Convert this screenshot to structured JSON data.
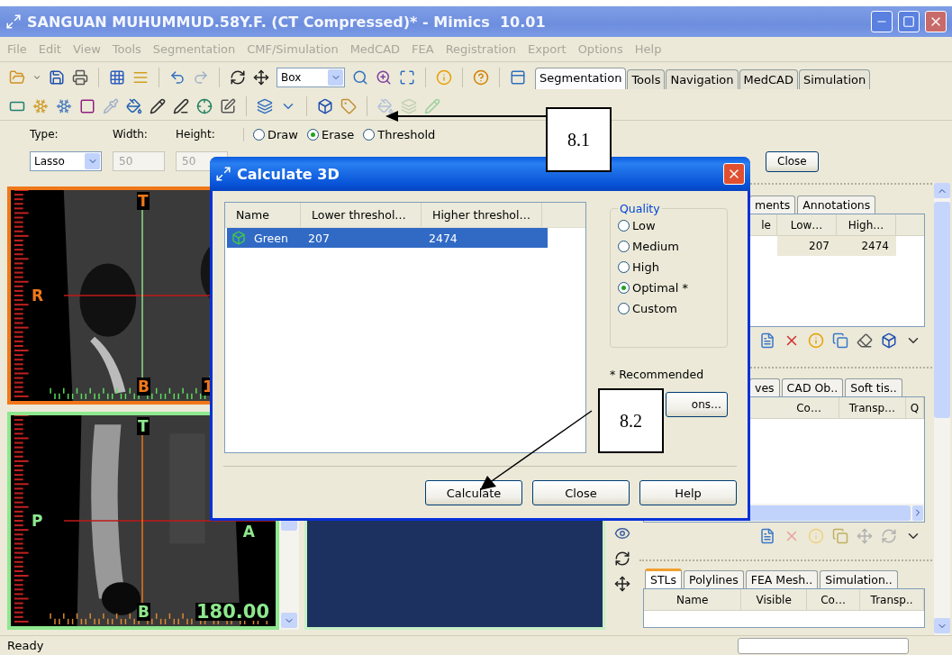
{
  "window": {
    "title": "SANGUAN MUHUMMUD.58Y.F. (CT Compressed)* - Mimics  10.01"
  },
  "menu": [
    "File",
    "Edit",
    "View",
    "Tools",
    "Segmentation",
    "CMF/Simulation",
    "MedCAD",
    "FEA",
    "Registration",
    "Export",
    "Options",
    "Help"
  ],
  "toolbar": {
    "view_mode": "Box"
  },
  "toolbar_tabs": [
    {
      "label": "Segmentation",
      "selected": true
    },
    {
      "label": "Tools",
      "selected": false
    },
    {
      "label": "Navigation",
      "selected": false
    },
    {
      "label": "MedCAD",
      "selected": false
    },
    {
      "label": "Simulation",
      "selected": false
    }
  ],
  "edit_options": {
    "type_label": "Type:",
    "type_value": "Lasso",
    "width_label": "Width:",
    "width_value": "50",
    "height_label": "Height:",
    "height_value": "50",
    "modes": [
      {
        "label": "Draw",
        "selected": false
      },
      {
        "label": "Erase",
        "selected": true
      },
      {
        "label": "Threshold",
        "selected": false
      }
    ],
    "close": "Close"
  },
  "viewports": [
    {
      "color": "#f07818",
      "markers": [
        {
          "text": "T",
          "kind": "top"
        },
        {
          "text": "R",
          "kind": "left"
        },
        {
          "text": "B",
          "kind": "bottom"
        },
        {
          "text": "1",
          "kind": "cut"
        }
      ]
    },
    {
      "color": "#8ee88e",
      "markers": [
        {
          "text": "T",
          "kind": "top"
        },
        {
          "text": "P",
          "kind": "left"
        },
        {
          "text": "A",
          "kind": "right"
        },
        {
          "text": "B",
          "kind": "bottom"
        },
        {
          "text": "180.00",
          "kind": "corner"
        }
      ]
    }
  ],
  "panels": [
    {
      "tabs": [
        {
          "label": "ments",
          "selected": false
        },
        {
          "label": "Annotations",
          "selected": false
        }
      ],
      "columns": [
        "le",
        "Low…",
        "High…"
      ],
      "rows": [
        [
          "",
          "207",
          "2474"
        ]
      ]
    },
    {
      "tabs": [
        {
          "label": "ves",
          "selected": false
        },
        {
          "label": "CAD Ob..",
          "selected": false
        },
        {
          "label": "Soft tis..",
          "selected": false
        }
      ],
      "columns": [
        "Co…",
        "Transp…",
        "Q"
      ]
    },
    {
      "tabs": [
        {
          "label": "STLs",
          "selected": true
        },
        {
          "label": "Polylines",
          "selected": false
        },
        {
          "label": "FEA Mesh..",
          "selected": false
        },
        {
          "label": "Simulation..",
          "selected": false
        }
      ],
      "columns": [
        "Name",
        "Visible",
        "Co…",
        "Transp.."
      ]
    }
  ],
  "status_bar": {
    "text": "Ready"
  },
  "dialog": {
    "title": "Calculate 3D",
    "columns": [
      "Name",
      "Lower threshol…",
      "Higher threshol…"
    ],
    "rows": [
      {
        "name": "Green",
        "lower": "207",
        "higher": "2474",
        "selected": true
      }
    ],
    "quality": {
      "title": "Quality",
      "options": [
        {
          "label": "Low",
          "selected": false
        },
        {
          "label": "Medium",
          "selected": false
        },
        {
          "label": "High",
          "selected": false
        },
        {
          "label": "Optimal *",
          "selected": true
        },
        {
          "label": "Custom",
          "selected": false
        }
      ]
    },
    "note": "* Recommended",
    "options_button": "ons…",
    "buttons": [
      "Calculate",
      "Close",
      "Help"
    ]
  },
  "callouts": [
    {
      "text": "8.1"
    },
    {
      "text": "8.2"
    }
  ]
}
